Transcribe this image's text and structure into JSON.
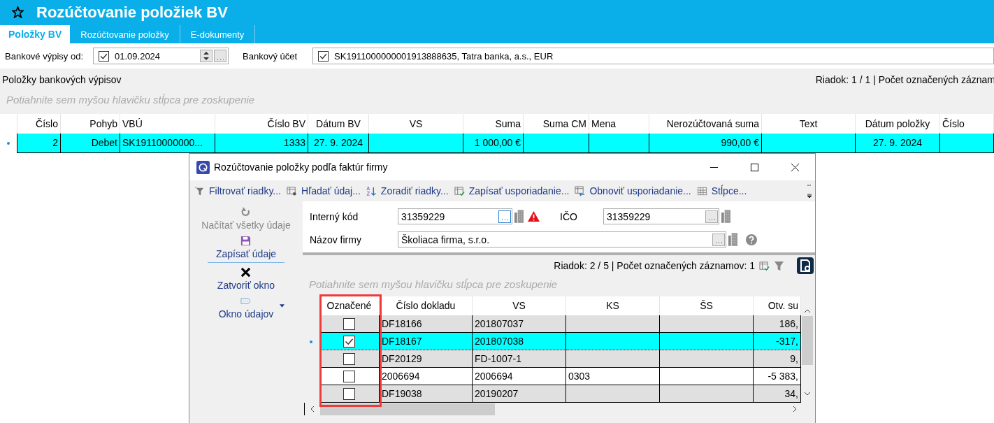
{
  "app": {
    "title": "Rozúčtovanie položiek BV"
  },
  "tabs": [
    {
      "label": "Položky BV",
      "selected": true
    },
    {
      "label": "Rozúčtovanie položky",
      "selected": false
    },
    {
      "label": "E-dokumenty",
      "selected": false
    }
  ],
  "filters": {
    "statements_from": {
      "label": "Bankové výpisy od:",
      "checked": true,
      "value": "01.09.2024"
    },
    "bank_account": {
      "label": "Bankový účet",
      "checked": true,
      "value": "SK1911000000001913888635, Tatra banka, a.s., EUR"
    }
  },
  "items_panel": {
    "title": "Položky bankových výpisov",
    "status": "Riadok: 1 / 1 | Počet označených záznam",
    "group_placeholder": "Potiahnite sem myšou hlavičku stĺpca pre zoskupenie",
    "columns": [
      "Číslo",
      "Pohyb",
      "VBÚ",
      "Číslo BV",
      "Dátum BV",
      "VS",
      "Suma",
      "Suma CM",
      "Mena",
      "Nerozúčtovaná suma",
      "Text",
      "Dátum položky",
      "Číslo"
    ],
    "rows": [
      {
        "selected": true,
        "cells": [
          "2",
          "Debet",
          "SK19110000000...",
          "1333",
          "27. 9. 2024",
          null,
          "1 000,00 €",
          null,
          null,
          "990,00 €",
          null,
          "27. 9. 2024",
          null
        ]
      }
    ]
  },
  "dialog": {
    "title": "Rozúčtovanie položky podľa faktúr firmy",
    "toolbar": [
      {
        "kind": "filter",
        "label": "Filtrovať riadky..."
      },
      {
        "kind": "search",
        "label": "Hľadať údaj..."
      },
      {
        "kind": "sort",
        "label": "Zoradiť riadky..."
      },
      {
        "kind": "save-layout",
        "label": "Zapísať usporiadanie..."
      },
      {
        "kind": "restore-layout",
        "label": "Obnoviť usporiadanie..."
      },
      {
        "kind": "columns",
        "label": "Stĺpce..."
      }
    ],
    "actions": [
      {
        "kind": "reload",
        "label": "Načítať všetky údaje",
        "disabled": true
      },
      {
        "kind": "save",
        "label": "Zapísať údaje",
        "disabled": false
      },
      {
        "kind": "close",
        "label": "Zatvoriť okno",
        "disabled": false
      },
      {
        "kind": "panel",
        "label": "Okno údajov",
        "disabled": false
      }
    ],
    "form": {
      "internal_code": {
        "label": "Interný kód",
        "value": "31359229",
        "warning": true
      },
      "ico": {
        "label": "IČO",
        "value": "31359229"
      },
      "company_name": {
        "label": "Názov firmy",
        "value": "Školiaca firma, s.r.o."
      }
    },
    "status": "Riadok: 2 / 5 | Počet označených záznamov: 1",
    "group_placeholder": "Potiahnite sem myšou hlavičku stĺpca pre zoskupenie",
    "check_column": "Označené",
    "columns": [
      "Číslo dokladu",
      "VS",
      "KS",
      "ŠS",
      "Otv. su"
    ],
    "rows": [
      {
        "checked": false,
        "selected": false,
        "cells": [
          "DF18166",
          "201807037",
          null,
          null,
          "186,"
        ]
      },
      {
        "checked": true,
        "selected": true,
        "cells": [
          "DF18167",
          "201807038",
          null,
          null,
          "-317,"
        ]
      },
      {
        "checked": false,
        "selected": false,
        "cells": [
          "DF20129",
          "FD-1007-1",
          null,
          null,
          "9,"
        ]
      },
      {
        "checked": false,
        "selected": false,
        "cells": [
          "2006694",
          "2006694",
          "0303",
          null,
          "-5 383,"
        ]
      },
      {
        "checked": false,
        "selected": false,
        "cells": [
          "DF19038",
          "20190207",
          null,
          null,
          "34,"
        ]
      }
    ]
  }
}
